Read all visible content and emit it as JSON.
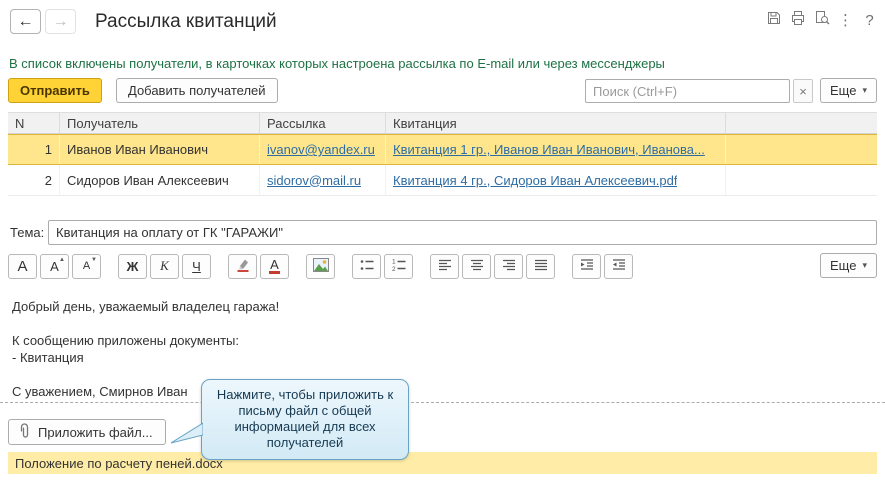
{
  "header": {
    "title": "Рассылка квитанций"
  },
  "icons": {
    "back": "←",
    "forward": "→",
    "kebab": "⋮",
    "help": "?",
    "clear": "×",
    "dropdown": "▾",
    "tri_up": "▲",
    "tri_down": "▼"
  },
  "info_text": "В список включены получатели, в карточках которых настроена рассылка по E-mail или через мессенджеры",
  "toolbar": {
    "send": "Отправить",
    "add_recipients": "Добавить получателей",
    "search_placeholder": "Поиск (Ctrl+F)",
    "more": "Еще"
  },
  "table": {
    "columns": [
      "N",
      "Получатель",
      "Рассылка",
      "Квитанция"
    ],
    "rows": [
      {
        "n": "1",
        "recipient": "Иванов Иван Иванович",
        "mailing": "ivanov@yandex.ru",
        "receipt": "Квитанция 1 гр., Иванов Иван Иванович, Иванова..."
      },
      {
        "n": "2",
        "recipient": "Сидоров Иван Алексеевич",
        "mailing": "sidorov@mail.ru",
        "receipt": "Квитанция 4 гр., Сидоров Иван Алексеевич.pdf"
      }
    ]
  },
  "subject": {
    "label": "Тема:",
    "value": "Квитанция на оплату от ГК \"ГАРАЖИ\""
  },
  "format_toolbar": {
    "font_letter": "А",
    "bold": "Ж",
    "italic": "К",
    "underline": "Ч",
    "color_letter": "А",
    "more": "Еще"
  },
  "message": {
    "text": "Добрый день, уважаемый владелец гаража!\n\nК сообщению приложены документы:\n- Квитанция\n\nС уважением, Смирнов Иван"
  },
  "tooltip": {
    "text": "Нажмите, чтобы приложить к письму файл с общей информацией для всех получателей"
  },
  "attachments": {
    "attach_button": "Приложить файл...",
    "files": [
      {
        "name": "Положение по расчету пеней.docx"
      }
    ]
  },
  "colors": {
    "send_button": "#FFD335",
    "selected_row": "#FFE68C",
    "attachment_row": "#FFECA6",
    "link": "#2E6DA4",
    "info_text": "#1E7145",
    "tooltip_border": "#68A3C6"
  }
}
